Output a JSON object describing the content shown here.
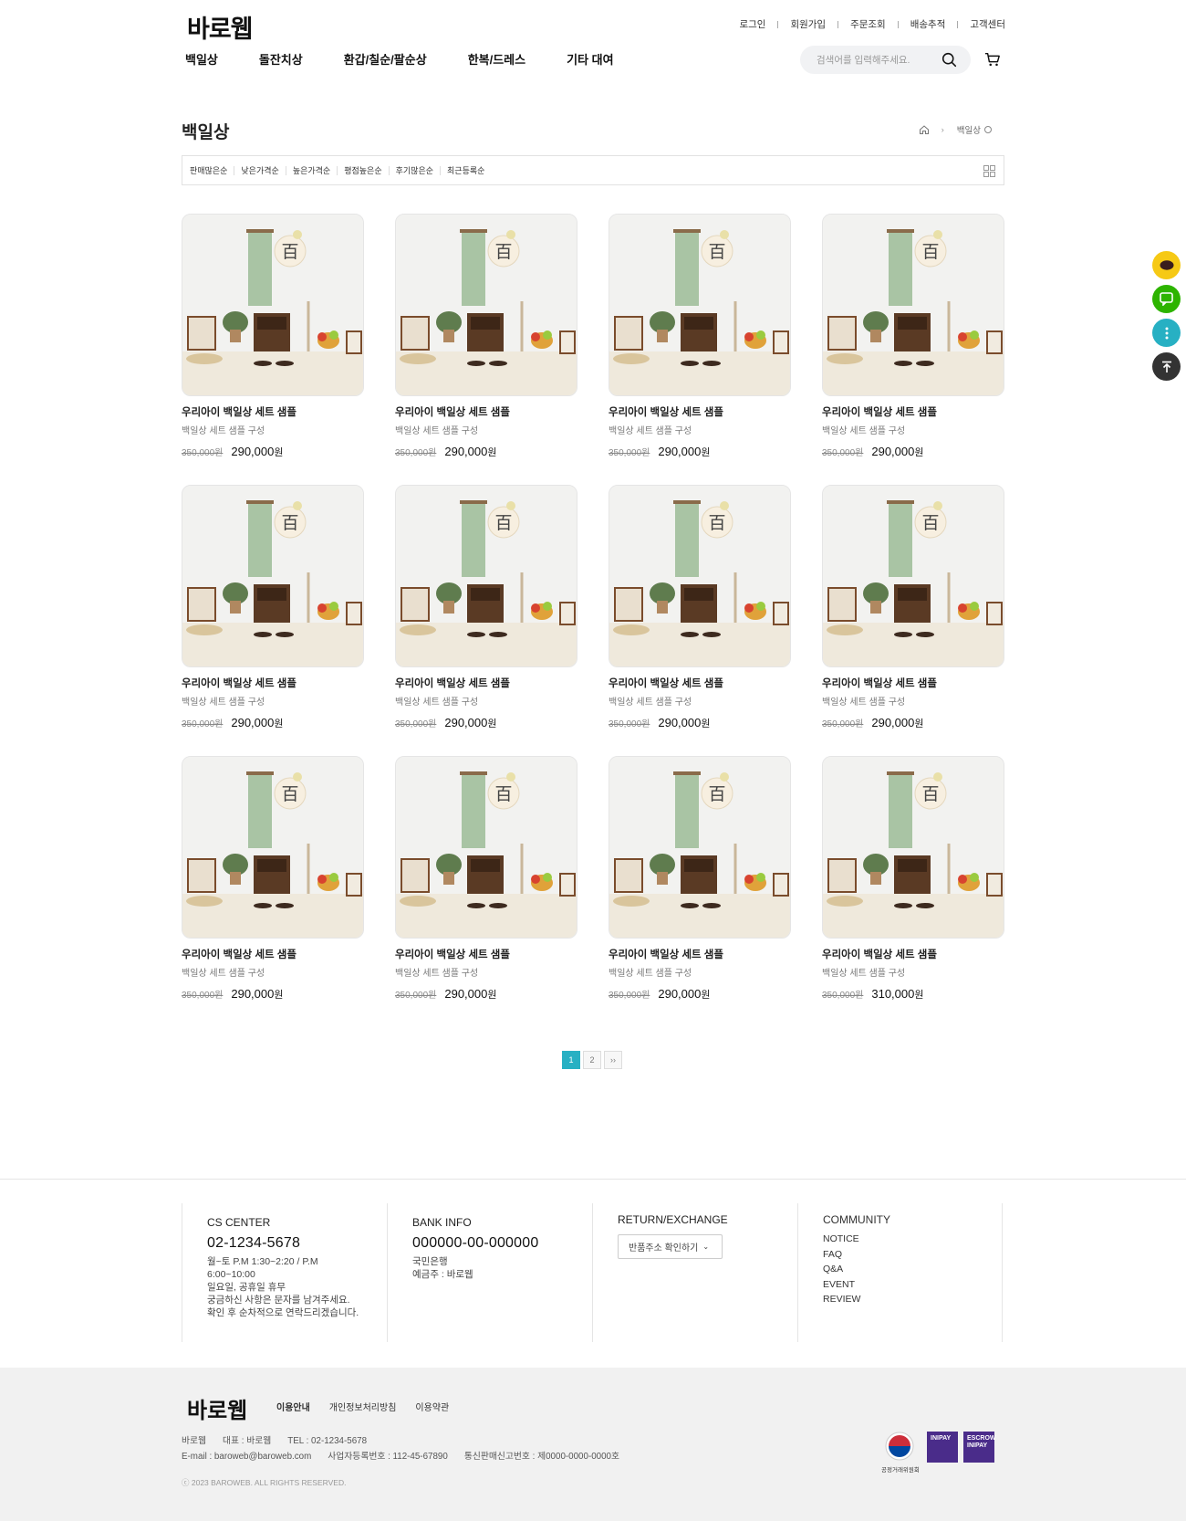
{
  "header": {
    "logo": "바로웹",
    "util_links": [
      "로그인",
      "회원가입",
      "주문조회",
      "배송추적",
      "고객센터"
    ],
    "nav": [
      "백일상",
      "돌잔치상",
      "환갑/칠순/팔순상",
      "한복/드레스",
      "기타 대여"
    ],
    "search_placeholder": "검색어를 입력해주세요.",
    "search_icon": "search-icon",
    "cart_icon": "cart-icon"
  },
  "page": {
    "title": "백일상",
    "breadcrumb_current": "백일상",
    "sort_options": [
      "판매많은순",
      "낮은가격순",
      "높은가격순",
      "평점높은순",
      "후기많은순",
      "최근등록순"
    ]
  },
  "products": [
    {
      "name": "우리아이 백일상 세트 샘플",
      "desc": "백일상 세트 샘플 구성",
      "old_price": "350,000원",
      "price": "290,000",
      "unit": "원"
    },
    {
      "name": "우리아이 백일상 세트 샘플",
      "desc": "백일상 세트 샘플 구성",
      "old_price": "350,000원",
      "price": "290,000",
      "unit": "원"
    },
    {
      "name": "우리아이 백일상 세트 샘플",
      "desc": "백일상 세트 샘플 구성",
      "old_price": "350,000원",
      "price": "290,000",
      "unit": "원"
    },
    {
      "name": "우리아이 백일상 세트 샘플",
      "desc": "백일상 세트 샘플 구성",
      "old_price": "350,000원",
      "price": "290,000",
      "unit": "원"
    },
    {
      "name": "우리아이 백일상 세트 샘플",
      "desc": "백일상 세트 샘플 구성",
      "old_price": "350,000원",
      "price": "290,000",
      "unit": "원"
    },
    {
      "name": "우리아이 백일상 세트 샘플",
      "desc": "백일상 세트 샘플 구성",
      "old_price": "350,000원",
      "price": "290,000",
      "unit": "원"
    },
    {
      "name": "우리아이 백일상 세트 샘플",
      "desc": "백일상 세트 샘플 구성",
      "old_price": "350,000원",
      "price": "290,000",
      "unit": "원"
    },
    {
      "name": "우리아이 백일상 세트 샘플",
      "desc": "백일상 세트 샘플 구성",
      "old_price": "350,000원",
      "price": "290,000",
      "unit": "원"
    },
    {
      "name": "우리아이 백일상 세트 샘플",
      "desc": "백일상 세트 샘플 구성",
      "old_price": "350,000원",
      "price": "290,000",
      "unit": "원"
    },
    {
      "name": "우리아이 백일상 세트 샘플",
      "desc": "백일상 세트 샘플 구성",
      "old_price": "350,000원",
      "price": "290,000",
      "unit": "원"
    },
    {
      "name": "우리아이 백일상 세트 샘플",
      "desc": "백일상 세트 샘플 구성",
      "old_price": "350,000원",
      "price": "290,000",
      "unit": "원"
    },
    {
      "name": "우리아이 백일상 세트 샘플",
      "desc": "백일상 세트 샘플 구성",
      "old_price": "350,000원",
      "price": "310,000",
      "unit": "원"
    }
  ],
  "pagination": {
    "pages": [
      "1",
      "2"
    ],
    "current": "1",
    "next": "››"
  },
  "footer": {
    "cs": {
      "title": "CS CENTER",
      "phone": "02-1234-5678",
      "hours1": "월~토 P.M 1:30~2:20 / P.M",
      "hours2": "6:00~10:00",
      "holiday": "일요일, 공휴일 휴무",
      "note1": "궁금하신 사항은 문자를 남겨주세요.",
      "note2": "확인 후 순차적으로 연락드리겠습니다."
    },
    "bank": {
      "title": "BANK INFO",
      "account": "000000-00-000000",
      "bank_name": "국민은행",
      "holder": "예금주 : 바로웹"
    },
    "return": {
      "title": "RETURN/EXCHANGE",
      "button": "반품주소 확인하기"
    },
    "community": {
      "title": "COMMUNITY",
      "links": [
        "NOTICE",
        "FAQ",
        "Q&A",
        "EVENT",
        "REVIEW"
      ]
    },
    "logo": "바로웹",
    "links": [
      "이용안내",
      "개인정보처리방침",
      "이용약관"
    ],
    "company": "바로웹",
    "ceo": "대표 : 바로웹",
    "tel": "TEL : 02-1234-5678",
    "email": "E-mail : baroweb@baroweb.com",
    "biz_no": "사업자등록번호 : 112-45-67890",
    "mail_order": "통신판매신고번호 : 제0000-0000-0000호",
    "copyright": "ⓒ 2023 BAROWEB. ALL RIGHTS RESERVED.",
    "seal_label": "공정거래위원회",
    "badge1": "INIPAY",
    "badge2_line1": "ESCROW",
    "badge2_line2": "INIPAY"
  },
  "floating": [
    {
      "icon": "talk-icon",
      "color": "#f6c915"
    },
    {
      "icon": "chat-icon",
      "color": "#2db400"
    },
    {
      "icon": "more-icon",
      "color": "#27b0c3"
    },
    {
      "icon": "top-arrow-icon",
      "color": "#333333"
    }
  ]
}
